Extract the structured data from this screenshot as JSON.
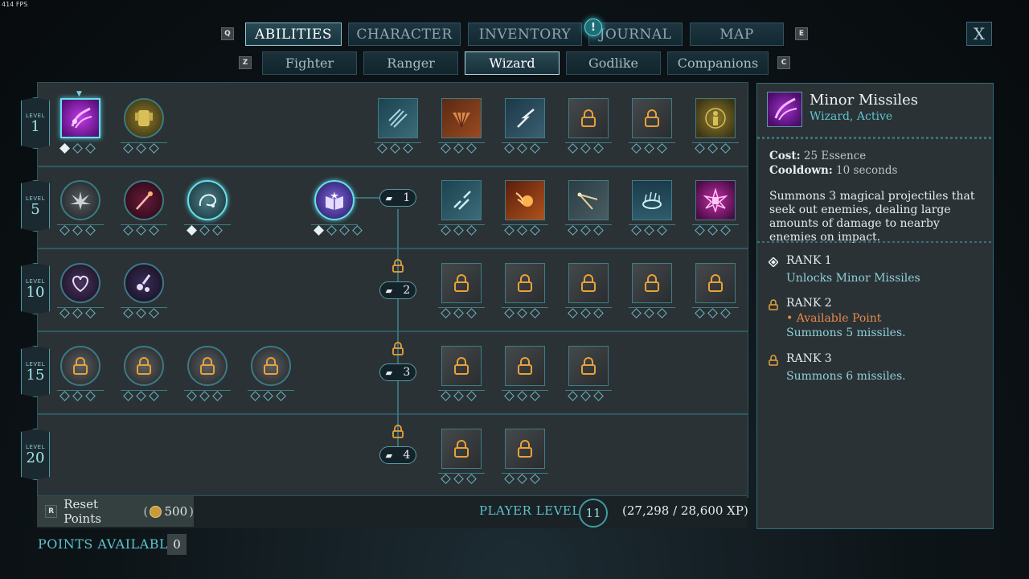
{
  "fps": "414 FPS",
  "top_tabs": {
    "left_key": "Q",
    "right_key": "E",
    "items": [
      {
        "label": "ABILITIES",
        "active": true
      },
      {
        "label": "CHARACTER",
        "active": false
      },
      {
        "label": "INVENTORY",
        "active": false
      },
      {
        "label": "JOURNAL",
        "active": false
      },
      {
        "label": "MAP",
        "active": false
      }
    ],
    "journal_notification": "!"
  },
  "sub_tabs": {
    "left_key": "Z",
    "right_key": "C",
    "items": [
      {
        "label": "Fighter",
        "active": false
      },
      {
        "label": "Ranger",
        "active": false
      },
      {
        "label": "Wizard",
        "active": true
      },
      {
        "label": "Godlike",
        "active": false
      },
      {
        "label": "Companions",
        "active": false
      }
    ]
  },
  "close_label": "X",
  "level_label": "LEVEL",
  "levels": [
    "1",
    "5",
    "10",
    "15",
    "20"
  ],
  "upgrade_tiers": [
    "1",
    "2",
    "3",
    "4"
  ],
  "footer": {
    "reset_key": "R",
    "reset_label": "Reset Points",
    "reset_cost": "500",
    "player_level_label": "PLAYER LEVEL",
    "player_level": "11",
    "xp": "(27,298 / 28,600 XP)",
    "points_available_label": "POINTS AVAILABLE",
    "points_available": "0"
  },
  "detail": {
    "name": "Minor Missiles",
    "subtitle": "Wizard, Active",
    "cost_label": "Cost:",
    "cost_value": "25 Essence",
    "cooldown_label": "Cooldown:",
    "cooldown_value": "10 seconds",
    "description": "Summons 3 magical projectiles that seek out enemies, dealing large amounts of damage to nearby enemies on impact.",
    "ranks": [
      {
        "title": "RANK 1",
        "available": "",
        "text": "Unlocks Minor Missiles"
      },
      {
        "title": "RANK 2",
        "available": "• Available Point",
        "text": "Summons 5 missiles."
      },
      {
        "title": "RANK 3",
        "available": "",
        "text": "Summons 6 missiles."
      }
    ]
  },
  "colors": {
    "accent": "#5ec4cc",
    "lock": "#e8a13a",
    "available": "#e8894a",
    "selected": "#66e0ea"
  }
}
